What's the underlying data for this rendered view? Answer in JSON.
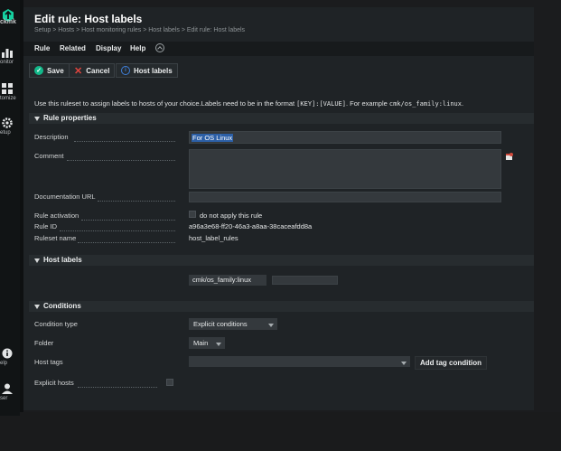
{
  "sidebar": {
    "logo_text": "ckmk",
    "items": [
      {
        "label": "onitor",
        "icon": "monitor-icon"
      },
      {
        "label": "tomize",
        "icon": "customize-icon"
      },
      {
        "label": "etup",
        "icon": "setup-icon"
      },
      {
        "label": "elp",
        "icon": "help-icon"
      },
      {
        "label": "ser",
        "icon": "user-icon"
      }
    ]
  },
  "header": {
    "title": "Edit rule: Host labels",
    "breadcrumb": "Setup > Hosts > Host monitoring rules > Host labels > Edit rule: Host labels"
  },
  "menu": [
    "Rule",
    "Related",
    "Display",
    "Help"
  ],
  "toolbar": {
    "save": "Save",
    "cancel": "Cancel",
    "host_labels": "Host labels"
  },
  "intro": {
    "before": "Use this ruleset to assign labels to hosts of your choice.Labels need to be in the format ",
    "format": "[KEY]:[VALUE]",
    "mid": ". For example ",
    "example": "cmk/os_family:linux",
    "after": "."
  },
  "rule_properties": {
    "title": "Rule properties",
    "description_label": "Description",
    "description_value": "For OS Linux",
    "comment_label": "Comment",
    "doc_url_label": "Documentation URL",
    "activation_label": "Rule activation",
    "activation_text": "do not apply this rule",
    "rule_id_label": "Rule ID",
    "rule_id_value": "a96a3e68-ff20-46a3-a8aa-38caceafdd8a",
    "ruleset_label": "Ruleset name",
    "ruleset_value": "host_label_rules"
  },
  "host_labels": {
    "title": "Host labels",
    "label_value": "cmk/os_family:linux"
  },
  "conditions": {
    "title": "Conditions",
    "condition_type_label": "Condition type",
    "condition_type_value": "Explicit conditions",
    "folder_label": "Folder",
    "folder_value": "Main",
    "host_tags_label": "Host tags",
    "add_tag_button": "Add tag condition",
    "explicit_hosts_label": "Explicit hosts"
  },
  "colors": {
    "brand": "#15d1a0",
    "save": "#13b88a",
    "cancel": "#e0453e",
    "host_labels": "#3f7fd8"
  }
}
